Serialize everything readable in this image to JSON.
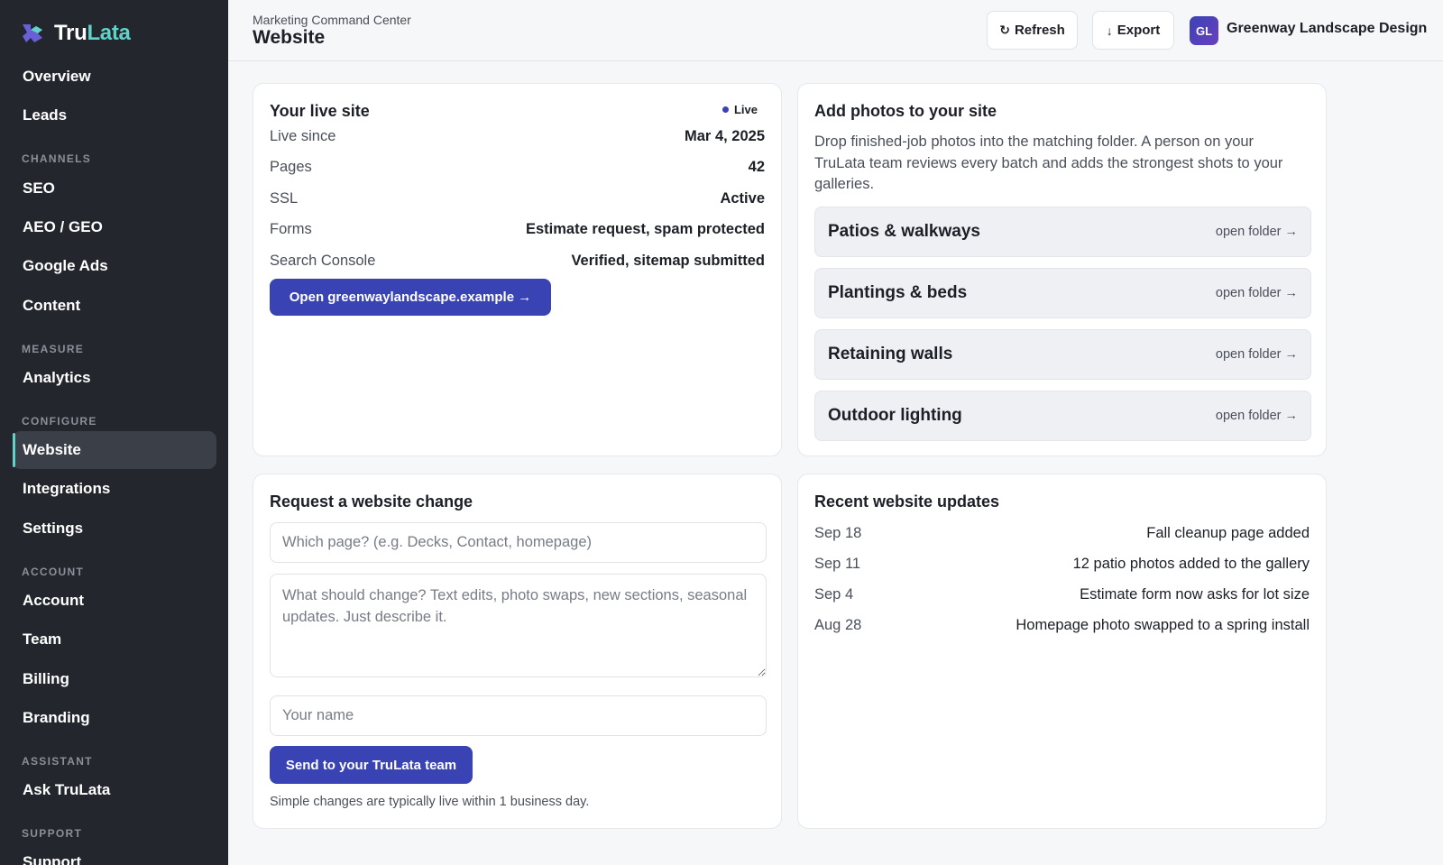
{
  "brand": {
    "name_part1": "Tru",
    "name_part2": "Lata",
    "accent": "#5fd3c9"
  },
  "sidebar": {
    "items": [
      {
        "label": "Overview"
      },
      {
        "label": "Leads"
      },
      {
        "section": "CHANNELS"
      },
      {
        "label": "SEO"
      },
      {
        "label": "AEO / GEO"
      },
      {
        "label": "Google Ads"
      },
      {
        "label": "Content"
      },
      {
        "section": "MEASURE"
      },
      {
        "label": "Analytics"
      },
      {
        "section": "CONFIGURE"
      },
      {
        "label": "Website",
        "active": true
      },
      {
        "label": "Integrations"
      },
      {
        "label": "Settings"
      },
      {
        "section": "ACCOUNT"
      },
      {
        "label": "Account"
      },
      {
        "label": "Team"
      },
      {
        "label": "Billing"
      },
      {
        "label": "Branding"
      },
      {
        "section": "ASSISTANT"
      },
      {
        "label": "Ask TruLata"
      },
      {
        "section": "SUPPORT"
      },
      {
        "label": "Support"
      }
    ]
  },
  "header": {
    "breadcrumb": "Marketing Command Center",
    "title": "Website",
    "refresh_label": "Refresh",
    "export_label": "Export",
    "avatar_initials": "GL",
    "org_name": "Greenway Landscape Design"
  },
  "live_site": {
    "title": "Your live site",
    "status": "Live",
    "rows": [
      {
        "label": "Live since",
        "value": "Mar 4, 2025"
      },
      {
        "label": "Pages",
        "value": "42"
      },
      {
        "label": "SSL",
        "value": "Active"
      },
      {
        "label": "Forms",
        "value": "Estimate request, spam protected"
      },
      {
        "label": "Search Console",
        "value": "Verified, sitemap submitted"
      }
    ],
    "open_button": "Open greenwaylandscape.example →"
  },
  "photos": {
    "title": "Add photos to your site",
    "description": "Drop finished-job photos into the matching folder. A person on your TruLata team reviews every batch and adds the strongest shots to your galleries.",
    "folders": [
      {
        "name": "Patios & walkways",
        "link": "open folder →"
      },
      {
        "name": "Plantings & beds",
        "link": "open folder →"
      },
      {
        "name": "Retaining walls",
        "link": "open folder →"
      },
      {
        "name": "Outdoor lighting",
        "link": "open folder →"
      }
    ]
  },
  "request": {
    "title": "Request a website change",
    "page_placeholder": "Which page? (e.g. Decks, Contact, homepage)",
    "change_placeholder": "What should change? Text edits, photo swaps, new sections, seasonal updates. Just describe it.",
    "name_placeholder": "Your name",
    "send_button": "Send to your TruLata team",
    "hint": "Simple changes are typically live within 1 business day."
  },
  "updates": {
    "title": "Recent website updates",
    "items": [
      {
        "date": "Sep 18",
        "text": "Fall cleanup page added"
      },
      {
        "date": "Sep 11",
        "text": "12 patio photos added to the gallery"
      },
      {
        "date": "Sep 4",
        "text": "Estimate form now asks for lot size"
      },
      {
        "date": "Aug 28",
        "text": "Homepage photo swapped to a spring install"
      }
    ]
  }
}
